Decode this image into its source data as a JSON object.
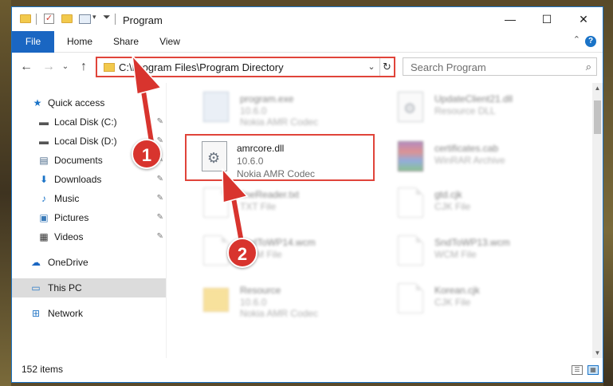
{
  "window": {
    "title": "Program",
    "minimize": "—",
    "maximize": "☐",
    "close": "✕"
  },
  "ribbon": {
    "tabs": [
      "File",
      "Home",
      "Share",
      "View"
    ],
    "help": "?",
    "collapse": "⌃"
  },
  "address": {
    "path": "C:\\Program Files\\Program Directory",
    "dropdown": "⌄",
    "refresh": "↻"
  },
  "nav": {
    "back": "←",
    "forward": "→",
    "recent": "⌄",
    "up": "↑"
  },
  "search": {
    "placeholder": "Search Program",
    "icon": "⌕"
  },
  "sidebar": {
    "items": [
      {
        "label": "Quick access",
        "icon": "star-icon",
        "glyph": "★",
        "color": "#1a73c7"
      },
      {
        "label": "Local Disk (C:)",
        "icon": "local-disk-icon",
        "glyph": "▬",
        "color": "#555555",
        "pinned": true
      },
      {
        "label": "Local Disk (D:)",
        "icon": "local-disk-icon",
        "glyph": "▬",
        "color": "#555555",
        "pinned": true
      },
      {
        "label": "Documents",
        "icon": "documents-icon",
        "glyph": "▤",
        "color": "#4a6a8a",
        "pinned": true
      },
      {
        "label": "Downloads",
        "icon": "downloads-icon",
        "glyph": "⬇",
        "color": "#1a73c7",
        "pinned": true
      },
      {
        "label": "Music",
        "icon": "music-icon",
        "glyph": "♪",
        "color": "#1a73c7",
        "pinned": true
      },
      {
        "label": "Pictures",
        "icon": "pictures-icon",
        "glyph": "▣",
        "color": "#3a7ab8",
        "pinned": true
      },
      {
        "label": "Videos",
        "icon": "videos-icon",
        "glyph": "▦",
        "color": "#333333",
        "pinned": true
      },
      {
        "label": "OneDrive",
        "icon": "onedrive-icon",
        "glyph": "☁",
        "color": "#1a66c2"
      },
      {
        "label": "This PC",
        "icon": "this-pc-icon",
        "glyph": "▭",
        "color": "#2a7ac7",
        "selected": true
      },
      {
        "label": "Network",
        "icon": "network-icon",
        "glyph": "⊞",
        "color": "#2a7ac7"
      }
    ],
    "pin_glyph": "📌"
  },
  "files": [
    {
      "name": "program.exe",
      "line2": "10.6.0",
      "line3": "Nokia AMR Codec",
      "icon": "exe-icon",
      "blurred": true
    },
    {
      "name": "UpdateClient21.dll",
      "line2": "Resource DLL",
      "line3": "",
      "icon": "dll-icon",
      "blurred": true
    },
    {
      "name": "amrcore.dll",
      "line2": "10.6.0",
      "line3": "Nokia AMR Codec",
      "icon": "dll-icon",
      "blurred": false
    },
    {
      "name": "certificates.cab",
      "line2": "WinRAR Archive",
      "line3": "",
      "icon": "winrar-icon",
      "blurred": true
    },
    {
      "name": "fineReader.txt",
      "line2": "TXT File",
      "line3": "",
      "icon": "document-icon",
      "blurred": true
    },
    {
      "name": "gtd.cjk",
      "line2": "CJK File",
      "line3": "",
      "icon": "document-icon",
      "blurred": true
    },
    {
      "name": "SndToWP14.wcm",
      "line2": "WCM File",
      "line3": "",
      "icon": "document-icon",
      "blurred": true
    },
    {
      "name": "SndToWP13.wcm",
      "line2": "WCM File",
      "line3": "",
      "icon": "document-icon",
      "blurred": true
    },
    {
      "name": "Resource",
      "line2": "10.6.0",
      "line3": "Nokia AMR Codec",
      "icon": "folder-icon",
      "blurred": true
    },
    {
      "name": "Korean.cjk",
      "line2": "CJK File",
      "line3": "",
      "icon": "document-icon",
      "blurred": true
    }
  ],
  "status": {
    "items_count": "152 items"
  },
  "callouts": [
    "1",
    "2"
  ],
  "colors": {
    "accent": "#1a66c2",
    "annotation_red": "#d8342e",
    "highlight_red": "#e0443a"
  }
}
